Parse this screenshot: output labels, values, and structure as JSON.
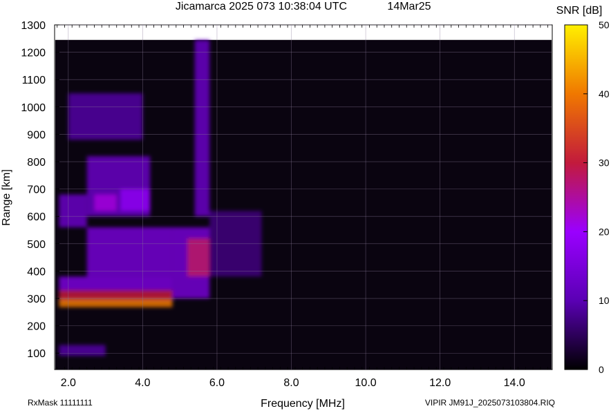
{
  "chart_data": {
    "type": "heatmap",
    "title": "Jicamarca 2025 073 10:38:04 UTC",
    "date_label": "14Mar25",
    "xlabel": "Frequency [MHz]",
    "ylabel": "Range [km]",
    "xlim": [
      1.65,
      15.0
    ],
    "ylim": [
      40,
      1300
    ],
    "xticks": [
      "2.0",
      "4.0",
      "6.0",
      "8.0",
      "10.0",
      "12.0",
      "14.0"
    ],
    "xtick_values": [
      2,
      4,
      6,
      8,
      10,
      12,
      14
    ],
    "yticks": [
      "100",
      "200",
      "300",
      "400",
      "500",
      "600",
      "700",
      "800",
      "900",
      "1000",
      "1100",
      "1200",
      "1300"
    ],
    "ytick_values": [
      100,
      200,
      300,
      400,
      500,
      600,
      700,
      800,
      900,
      1000,
      1100,
      1200,
      1300
    ],
    "data_top_km": 1245,
    "colorbar": {
      "label": "SNR [dB]",
      "range": [
        0,
        50
      ],
      "ticks": [
        "0",
        "10",
        "20",
        "30",
        "40",
        "50"
      ],
      "tick_values": [
        0,
        10,
        20,
        30,
        40,
        50
      ]
    },
    "echo_regions": [
      {
        "f": [
          1.75,
          4.8
        ],
        "range": [
          268,
          300
        ],
        "snr": 40
      },
      {
        "f": [
          1.75,
          4.8
        ],
        "range": [
          295,
          330
        ],
        "snr": 30
      },
      {
        "f": [
          1.75,
          4.8
        ],
        "range": [
          330,
          380
        ],
        "snr": 15
      },
      {
        "f": [
          2.5,
          4.8
        ],
        "range": [
          380,
          560
        ],
        "snr": 14
      },
      {
        "f": [
          4.8,
          5.8
        ],
        "range": [
          300,
          560
        ],
        "snr": 14
      },
      {
        "f": [
          5.2,
          5.8
        ],
        "range": [
          380,
          520
        ],
        "snr": 28
      },
      {
        "f": [
          1.75,
          2.5
        ],
        "range": [
          560,
          680
        ],
        "snr": 12
      },
      {
        "f": [
          2.5,
          4.2
        ],
        "range": [
          600,
          820
        ],
        "snr": 12
      },
      {
        "f": [
          2.7,
          3.3
        ],
        "range": [
          620,
          680
        ],
        "snr": 22
      },
      {
        "f": [
          3.4,
          4.2
        ],
        "range": [
          620,
          700
        ],
        "snr": 18
      },
      {
        "f": [
          2.0,
          4.0
        ],
        "range": [
          880,
          1050
        ],
        "snr": 9
      },
      {
        "f": [
          5.4,
          5.8
        ],
        "range": [
          600,
          1245
        ],
        "snr": 12
      },
      {
        "f": [
          1.75,
          3.0
        ],
        "range": [
          90,
          130
        ],
        "snr": 9
      },
      {
        "f": [
          5.8,
          7.2
        ],
        "range": [
          380,
          620
        ],
        "snr": 7
      }
    ]
  },
  "footer": {
    "left": "RxMask 11111111",
    "right": "VIPIR  JM91J_2025073103804.RIQ"
  }
}
